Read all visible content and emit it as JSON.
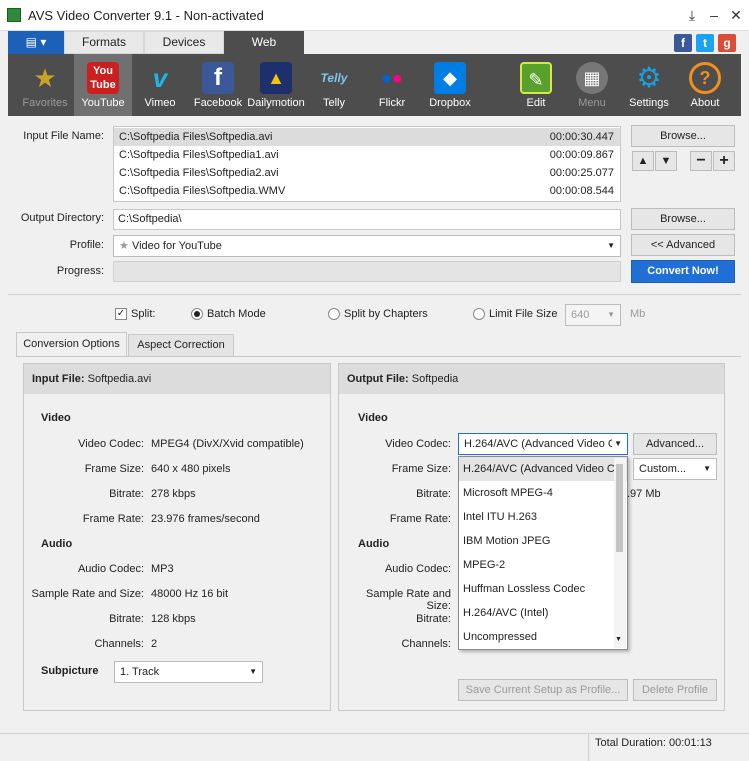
{
  "app": {
    "title": "AVS Video Converter 9.1 - Non-activated"
  },
  "tabs": [
    {
      "label": "Formats"
    },
    {
      "label": "Devices"
    },
    {
      "label": "Web"
    }
  ],
  "toolbar": [
    {
      "label": "Favorites",
      "icon": "star-icon"
    },
    {
      "label": "YouTube",
      "icon": "youtube-icon"
    },
    {
      "label": "Vimeo",
      "icon": "vimeo-icon"
    },
    {
      "label": "Facebook",
      "icon": "facebook-icon"
    },
    {
      "label": "Dailymotion",
      "icon": "dailymotion-icon"
    },
    {
      "label": "Telly",
      "icon": "telly-icon"
    },
    {
      "label": "Flickr",
      "icon": "flickr-icon"
    },
    {
      "label": "Dropbox",
      "icon": "dropbox-icon"
    },
    {
      "label": "Edit",
      "icon": "edit-icon"
    },
    {
      "label": "Menu",
      "icon": "menu-icon"
    },
    {
      "label": "Settings",
      "icon": "gear-icon"
    },
    {
      "label": "About",
      "icon": "help-icon"
    }
  ],
  "input": {
    "label": "Input File Name:",
    "files": [
      {
        "path": "C:\\Softpedia Files\\Softpedia.avi",
        "duration": "00:00:30.447"
      },
      {
        "path": "C:\\Softpedia Files\\Softpedia1.avi",
        "duration": "00:00:09.867"
      },
      {
        "path": "C:\\Softpedia Files\\Softpedia2.avi",
        "duration": "00:00:25.077"
      },
      {
        "path": "C:\\Softpedia Files\\Softpedia.WMV",
        "duration": "00:00:08.544"
      }
    ]
  },
  "output": {
    "label": "Output Directory:",
    "value": "C:\\Softpedia\\"
  },
  "profile": {
    "label": "Profile:",
    "value": "Video for YouTube"
  },
  "progress": {
    "label": "Progress:"
  },
  "buttons": {
    "browse": "Browse...",
    "advanced_toggle": "<< Advanced",
    "convert": "Convert Now!",
    "advanced": "Advanced...",
    "save_setup": "Save Current Setup as Profile...",
    "delete_profile": "Delete Profile"
  },
  "options": {
    "split": "Split:",
    "batch": "Batch Mode",
    "chapters": "Split by Chapters",
    "limit": "Limit File Size",
    "limit_value": "640",
    "limit_unit": "Mb"
  },
  "subtabs": [
    "Conversion Options",
    "Aspect Correction"
  ],
  "left": {
    "head_label": "Input File:",
    "head_value": "Softpedia.avi",
    "video": "Video",
    "video_rows": [
      {
        "k": "Video Codec:",
        "v": "MPEG4 (DivX/Xvid compatible)"
      },
      {
        "k": "Frame Size:",
        "v": "640 x 480 pixels"
      },
      {
        "k": "Bitrate:",
        "v": "278 kbps"
      },
      {
        "k": "Frame Rate:",
        "v": "23.976 frames/second"
      }
    ],
    "audio": "Audio",
    "audio_rows": [
      {
        "k": "Audio Codec:",
        "v": "MP3"
      },
      {
        "k": "Sample Rate and Size:",
        "v": "48000 Hz 16 bit"
      },
      {
        "k": "Bitrate:",
        "v": "128 kbps"
      },
      {
        "k": "Channels:",
        "v": "2"
      }
    ],
    "subpicture": "Subpicture",
    "subpicture_value": "1. Track"
  },
  "right": {
    "head_label": "Output File:",
    "head_value": "Softpedia",
    "video": "Video",
    "audio": "Audio",
    "video_codec_label": "Video Codec:",
    "video_codec_value": "H.264/AVC (Advanced Video C",
    "frame_size_label": "Frame Size:",
    "frame_size_value": "Custom...",
    "bitrate_label": "Bitrate:",
    "bitrate_tail": ".97 Mb",
    "frame_rate_label": "Frame Rate:",
    "audio_codec_label": "Audio Codec:",
    "sample_label": "Sample Rate and Size:",
    "audio_bitrate_label": "Bitrate:",
    "channels_label": "Channels:",
    "codec_options": [
      "H.264/AVC (Advanced Video C",
      "Microsoft MPEG-4",
      "Intel ITU H.263",
      "IBM Motion JPEG",
      "MPEG-2",
      "Huffman Lossless Codec",
      "H.264/AVC (Intel)",
      "Uncompressed"
    ]
  },
  "status": {
    "total": "Total Duration: 00:01:13"
  }
}
